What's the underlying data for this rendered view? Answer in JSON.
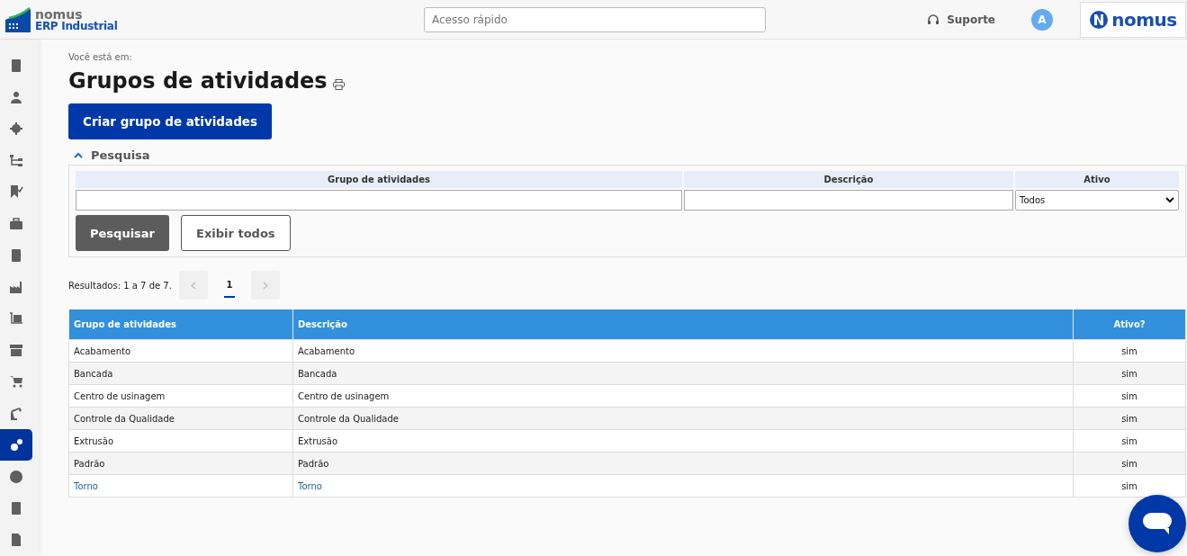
{
  "header": {
    "logo_brand": "nomus",
    "logo_product": "ERP Industrial",
    "quick_access": {
      "placeholder": "Acesso rápido"
    },
    "support": "Suporte",
    "avatar": "A",
    "corner_logo": "nomus"
  },
  "sidebar": {
    "items": [
      {
        "selected": false
      },
      {
        "selected": false
      },
      {
        "selected": false
      },
      {
        "selected": false
      },
      {
        "selected": false
      },
      {
        "selected": false
      },
      {
        "selected": false
      },
      {
        "selected": false
      },
      {
        "selected": false
      },
      {
        "selected": false
      },
      {
        "selected": false
      },
      {
        "selected": false
      },
      {
        "selected": true
      },
      {
        "selected": false
      },
      {
        "selected": false
      },
      {
        "selected": false
      }
    ]
  },
  "breadcrumb": "Você está em:",
  "page_title": "Grupos de atividades",
  "create_button": "Criar grupo de atividades",
  "search_panel": {
    "title": "Pesquisa",
    "expanded": true,
    "fields": [
      {
        "label": "Grupo de atividades",
        "kind": "text"
      },
      {
        "label": "Descrição",
        "kind": "text"
      },
      {
        "label": "Ativo",
        "kind": "select",
        "value": "Todos"
      }
    ],
    "buttons": [
      {
        "label": "Pesquisar",
        "kind": "primary"
      },
      {
        "label": "Exibir todos",
        "kind": "secondary"
      }
    ]
  },
  "results": {
    "summary": "Resultados: 1 a 7 de 7.",
    "pages": [
      {
        "label": "1",
        "selected": true
      }
    ]
  },
  "table": {
    "columns": [
      "Grupo de atividades",
      "Descrição",
      "Ativo?"
    ],
    "rows": [
      {
        "cells": [
          "Acabamento",
          "Acabamento",
          "sim"
        ],
        "highlighted": false
      },
      {
        "cells": [
          "Bancada",
          "Bancada",
          "sim"
        ],
        "highlighted": false
      },
      {
        "cells": [
          "Centro de usinagem",
          "Centro de usinagem",
          "sim"
        ],
        "highlighted": false
      },
      {
        "cells": [
          "Controle da Qualidade",
          "Controle da Qualidade",
          "sim"
        ],
        "highlighted": false
      },
      {
        "cells": [
          "Extrusão",
          "Extrusão",
          "sim"
        ],
        "highlighted": false
      },
      {
        "cells": [
          "Padrão",
          "Padrão",
          "sim"
        ],
        "highlighted": false
      },
      {
        "cells": [
          "Torno",
          "Torno",
          "sim"
        ],
        "highlighted": true
      }
    ]
  }
}
